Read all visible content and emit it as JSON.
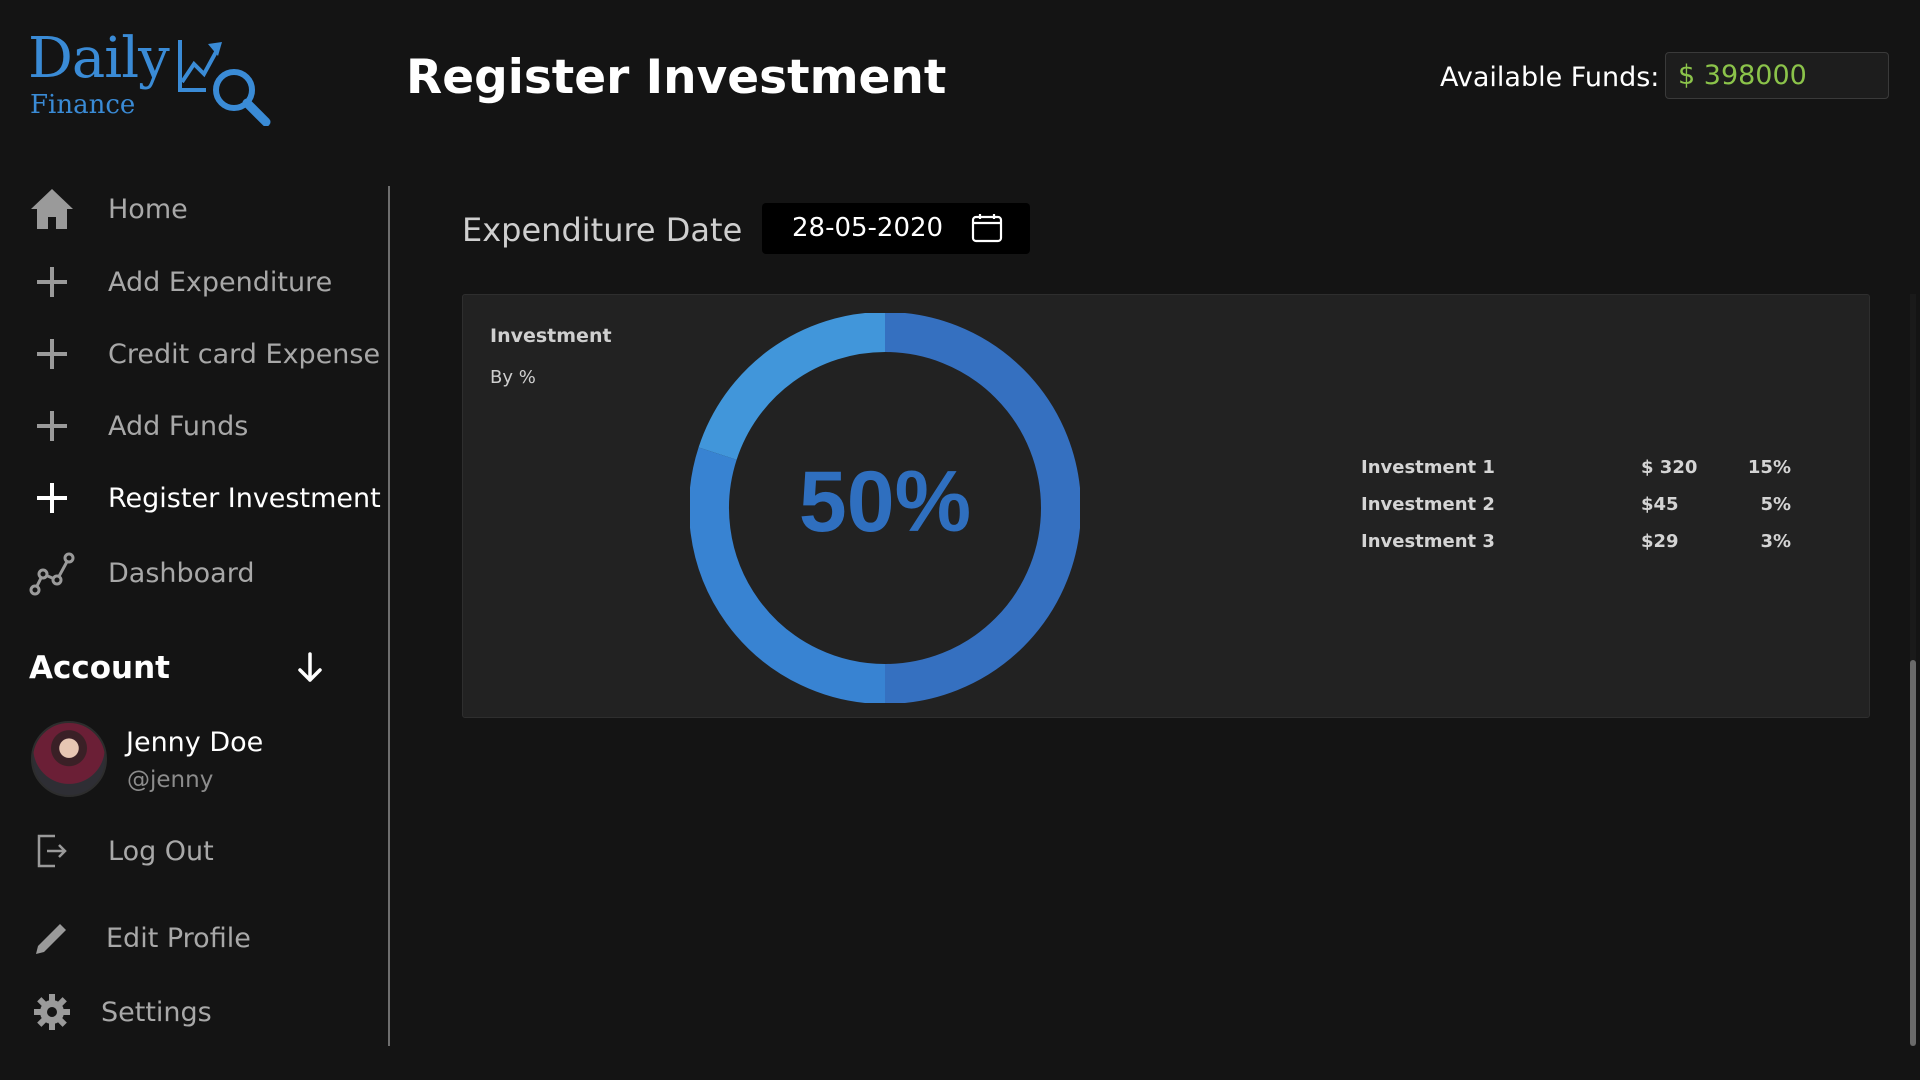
{
  "logo": {
    "word1": "Daily",
    "word2": "Finance"
  },
  "header": {
    "title": "Register Investment",
    "funds_label": "Available Funds:",
    "funds_value": "$ 398000"
  },
  "sidebar": {
    "items": [
      {
        "label": "Home",
        "icon": "home-icon"
      },
      {
        "label": "Add Expenditure",
        "icon": "plus-icon"
      },
      {
        "label": "Credit card Expense",
        "icon": "plus-icon"
      },
      {
        "label": "Add Funds",
        "icon": "plus-icon"
      },
      {
        "label": "Register Investment",
        "icon": "plus-icon",
        "active": true
      },
      {
        "label": "Dashboard",
        "icon": "line-chart-icon"
      }
    ],
    "account": {
      "title": "Account",
      "name": "Jenny Doe",
      "handle": "@jenny"
    },
    "bottom_items": [
      {
        "label": "Log Out",
        "icon": "logout-icon"
      },
      {
        "label": "Edit Profile",
        "icon": "pencil-icon"
      },
      {
        "label": "Settings",
        "icon": "gear-icon"
      }
    ]
  },
  "form": {
    "date_label": "Expenditure Date",
    "date_value": "28-05-2020"
  },
  "chart_data": {
    "type": "pie",
    "title": "Investment",
    "subtitle": "By %",
    "center_label": "50%",
    "center_value": 50,
    "legend": [
      {
        "name": "Investment 1",
        "amount": "$ 320",
        "percent": "15%"
      },
      {
        "name": "Investment 2",
        "amount": "$45",
        "percent": "5%"
      },
      {
        "name": "Investment 3",
        "amount": "$29",
        "percent": "3%"
      }
    ],
    "segments": [
      {
        "value": 50,
        "color": "#3570c0"
      },
      {
        "value": 30,
        "color": "#3883d2"
      },
      {
        "value": 20,
        "color": "#4196da"
      }
    ]
  },
  "colors": {
    "accent": "#3a8bd6",
    "funds_text": "#8bc34a",
    "background": "#141414",
    "card": "#222222"
  }
}
